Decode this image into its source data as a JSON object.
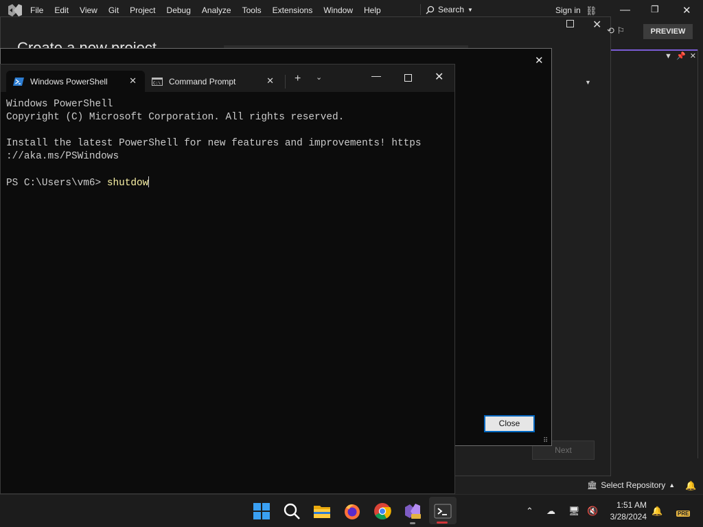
{
  "vs": {
    "menu": [
      "File",
      "Edit",
      "View",
      "Git",
      "Project",
      "Debug",
      "Analyze",
      "Tools",
      "Extensions",
      "Window",
      "Help"
    ],
    "search_label": "Search",
    "sign_in": "Sign in",
    "dialog_title": "Create a new project",
    "preview_label": "PREVIEW",
    "next_label": "Next",
    "status_repo": "Select Repository"
  },
  "dialog": {
    "close_label": "Close"
  },
  "terminal": {
    "tabs": [
      {
        "label": "Windows PowerShell",
        "active": true
      },
      {
        "label": "Command Prompt",
        "active": false
      }
    ],
    "lines": [
      "Windows PowerShell",
      "Copyright (C) Microsoft Corporation. All rights reserved.",
      "",
      "Install the latest PowerShell for new features and improvements! https",
      "://aka.ms/PSWindows",
      ""
    ],
    "prompt": "PS C:\\Users\\vm6> ",
    "command": "shutdow"
  },
  "taskbar": {
    "time": "1:51 AM",
    "date": "3/28/2024",
    "pre_badge": "PRE"
  },
  "colors": {
    "accent_purple": "#7b5cd6",
    "powershell_blue": "#2d7dd2",
    "command_yellow": "#f9f1a5"
  }
}
